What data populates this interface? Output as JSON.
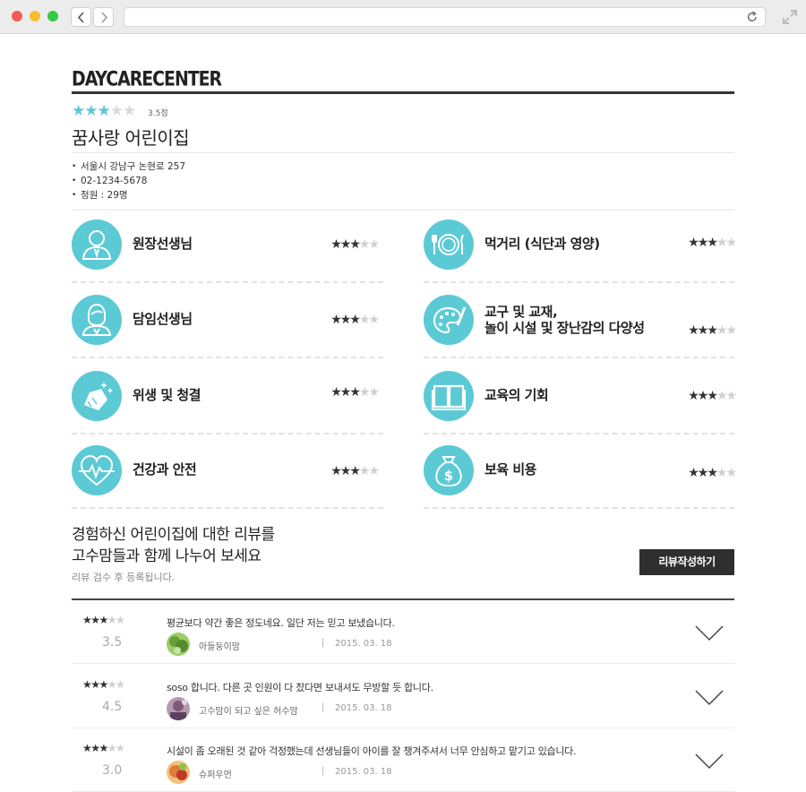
{
  "brand": "DAYCARECENTER",
  "header": {
    "rating_text": "3.5점",
    "stars_filled": 3,
    "stars_total": 5,
    "name": "꿈사랑 어린이집",
    "info": [
      "서울시 강남구 논현로 257",
      "02-1234-5678",
      "정원 : 29명"
    ]
  },
  "ratings": [
    {
      "label": "원장선생님",
      "icon": "director-icon",
      "stars_filled": 3
    },
    {
      "label": "먹거리 (식단과 영양)",
      "icon": "plate-icon",
      "stars_filled": 3
    },
    {
      "label": "담임선생님",
      "icon": "teacher-icon",
      "stars_filled": 3
    },
    {
      "label1": "교구 및 교재,",
      "label2": "놀이 시설 및 장난감의 다양성",
      "icon": "palette-icon",
      "stars_filled": 3
    },
    {
      "label": "위생 및 청결",
      "icon": "cleaning-icon",
      "stars_filled": 3
    },
    {
      "label": "교육의 기회",
      "icon": "book-icon",
      "stars_filled": 3
    },
    {
      "label": "건강과 안전",
      "icon": "heartbeat-icon",
      "stars_filled": 3
    },
    {
      "label": "보육 비용",
      "icon": "money-bag-icon",
      "stars_filled": 3
    }
  ],
  "promo": {
    "line1": "경험하신 어린이집에 대한 리뷰를",
    "line2": "고수맘들과 함께 나누어 보세요",
    "sub": "리뷰 검수 후 등록됩니다.",
    "button": "리뷰작성하기"
  },
  "reviews": [
    {
      "stars_filled": 3,
      "score": "3.5",
      "text": "평균보다 약간 좋은 정도네요. 일단 저는 믿고 보냈습니다.",
      "author": "아들둥이맘",
      "date": "2015. 03. 18",
      "avatar_color": "#7cb342"
    },
    {
      "stars_filled": 3,
      "score": "4.5",
      "text": "soso 합니다. 다른 곳 인원이 다 찼다면 보내셔도 무방할 듯 합니다.",
      "author": "고수맘이 되고 싶은 허수맘",
      "date": "2015. 03. 18",
      "avatar_color": "#8d6e8a"
    },
    {
      "stars_filled": 3,
      "score": "3.0",
      "text": "시설이 좀 오래된 것 같아 걱정했는데 선생님들이 아이를 잘 챙겨주셔서 너무 안심하고 맡기고 있습니다.",
      "author": "슈퍼우먼",
      "date": "2015. 03. 18",
      "avatar_color": "#d98b4a"
    }
  ],
  "separator": "|",
  "colors": {
    "accent": "#5ccad5",
    "dark": "#2f2f2f"
  }
}
